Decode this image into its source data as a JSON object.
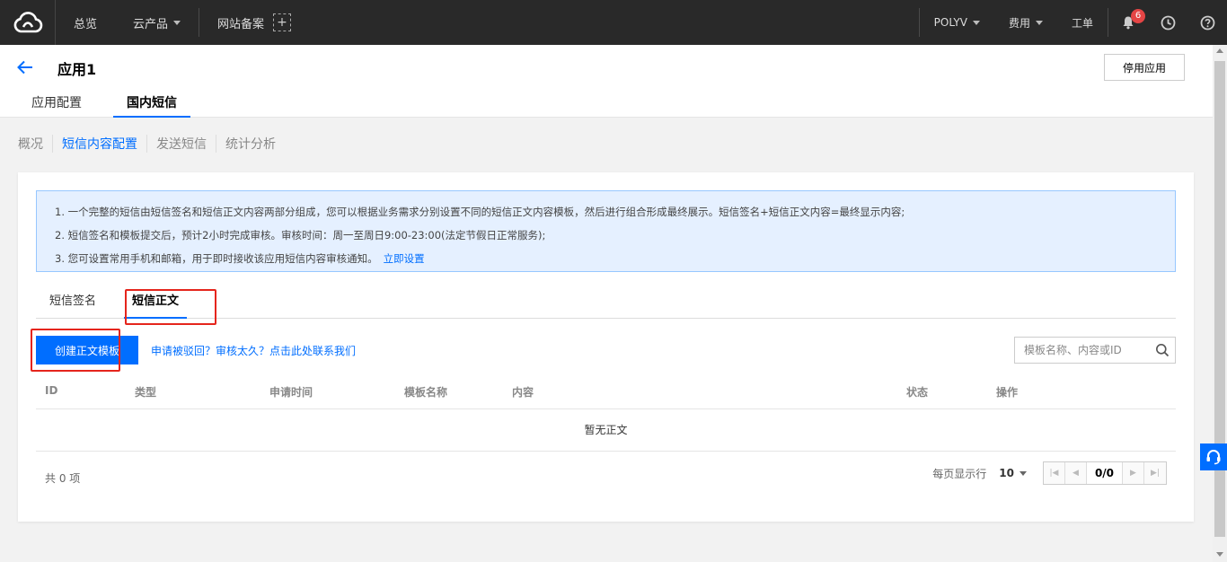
{
  "topnav": {
    "overview": "总览",
    "products": "云产品",
    "beian": "网站备案",
    "plus": "+",
    "account": "POLYV",
    "billing": "费用",
    "ticket": "工单",
    "notification_count": "6"
  },
  "header": {
    "title": "应用1",
    "stop_label": "停用应用",
    "tabs": [
      "应用配置",
      "国内短信"
    ]
  },
  "subnav": [
    "概况",
    "短信内容配置",
    "发送短信",
    "统计分析"
  ],
  "tips": {
    "line1": "1. 一个完整的短信由短信签名和短信正文内容两部分组成，您可以根据业务需求分别设置不同的短信正文内容模板，然后进行组合形成最终展示。短信签名+短信正文内容=最终显示内容;",
    "line2": "2. 短信签名和模板提交后，预计2小时完成审核。审核时间：周一至周日9:00-23:00(法定节假日正常服务);",
    "line3": "3. 您可设置常用手机和邮箱，用于即时接收该应用短信内容审核通知。",
    "line3_link": "立即设置"
  },
  "content_tabs": [
    "短信签名",
    "短信正文"
  ],
  "toolbar": {
    "create_label": "创建正文模板",
    "help_link": "申请被驳回？审核太久？点击此处联系我们",
    "search_placeholder": "模板名称、内容或ID"
  },
  "table": {
    "columns": [
      "ID",
      "类型",
      "申请时间",
      "模板名称",
      "内容",
      "状态",
      "操作"
    ],
    "empty_text": "暂无正文"
  },
  "pagination": {
    "total": "共 0 项",
    "per_page_label": "每页显示行",
    "per_page": "10",
    "page_indicator": "0/0"
  },
  "colors": {
    "primary": "#006eff",
    "highlight_border": "#e5251c",
    "badge": "#e54545",
    "topnav_bg": "#292929"
  }
}
